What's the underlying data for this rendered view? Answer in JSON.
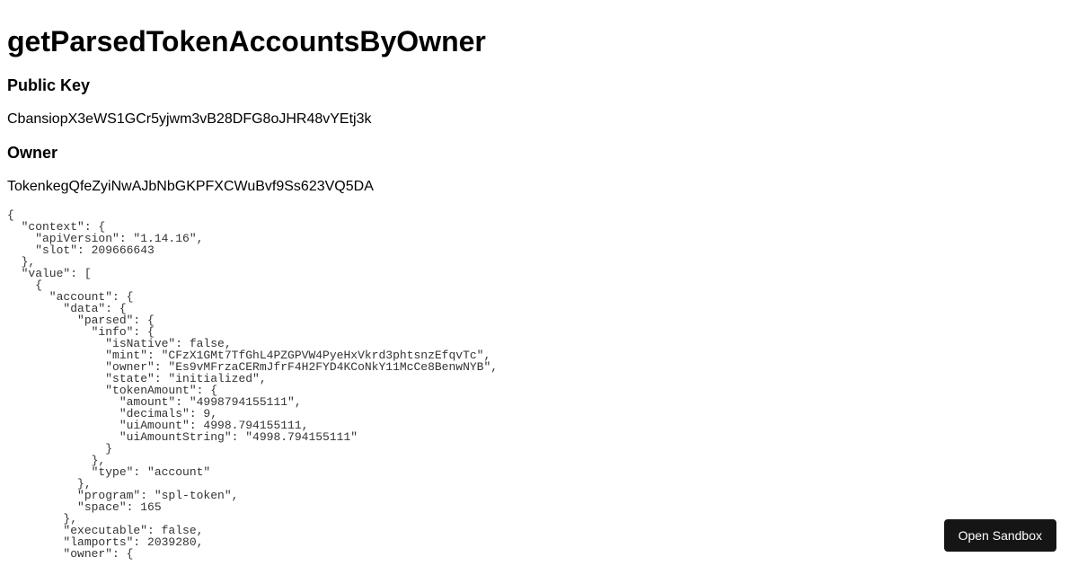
{
  "title": "getParsedTokenAccountsByOwner",
  "sections": {
    "publicKey": {
      "label": "Public Key",
      "value": "CbansiopX3eWS1GCr5yjwm3vB28DFG8oJHR48vYEtj3k"
    },
    "owner": {
      "label": "Owner",
      "value": "TokenkegQfeZyiNwAJbNbGKPFXCWuBvf9Ss623VQ5DA"
    }
  },
  "jsonOutput": "{\n  \"context\": {\n    \"apiVersion\": \"1.14.16\",\n    \"slot\": 209666643\n  },\n  \"value\": [\n    {\n      \"account\": {\n        \"data\": {\n          \"parsed\": {\n            \"info\": {\n              \"isNative\": false,\n              \"mint\": \"CFzX1GMt7TfGhL4PZGPVW4PyeHxVkrd3phtsnzEfqvTc\",\n              \"owner\": \"Es9vMFrzaCERmJfrF4H2FYD4KCoNkY11McCe8BenwNYB\",\n              \"state\": \"initialized\",\n              \"tokenAmount\": {\n                \"amount\": \"4998794155111\",\n                \"decimals\": 9,\n                \"uiAmount\": 4998.794155111,\n                \"uiAmountString\": \"4998.794155111\"\n              }\n            },\n            \"type\": \"account\"\n          },\n          \"program\": \"spl-token\",\n          \"space\": 165\n        },\n        \"executable\": false,\n        \"lamports\": 2039280,\n        \"owner\": {",
  "button": {
    "label": "Open Sandbox"
  }
}
